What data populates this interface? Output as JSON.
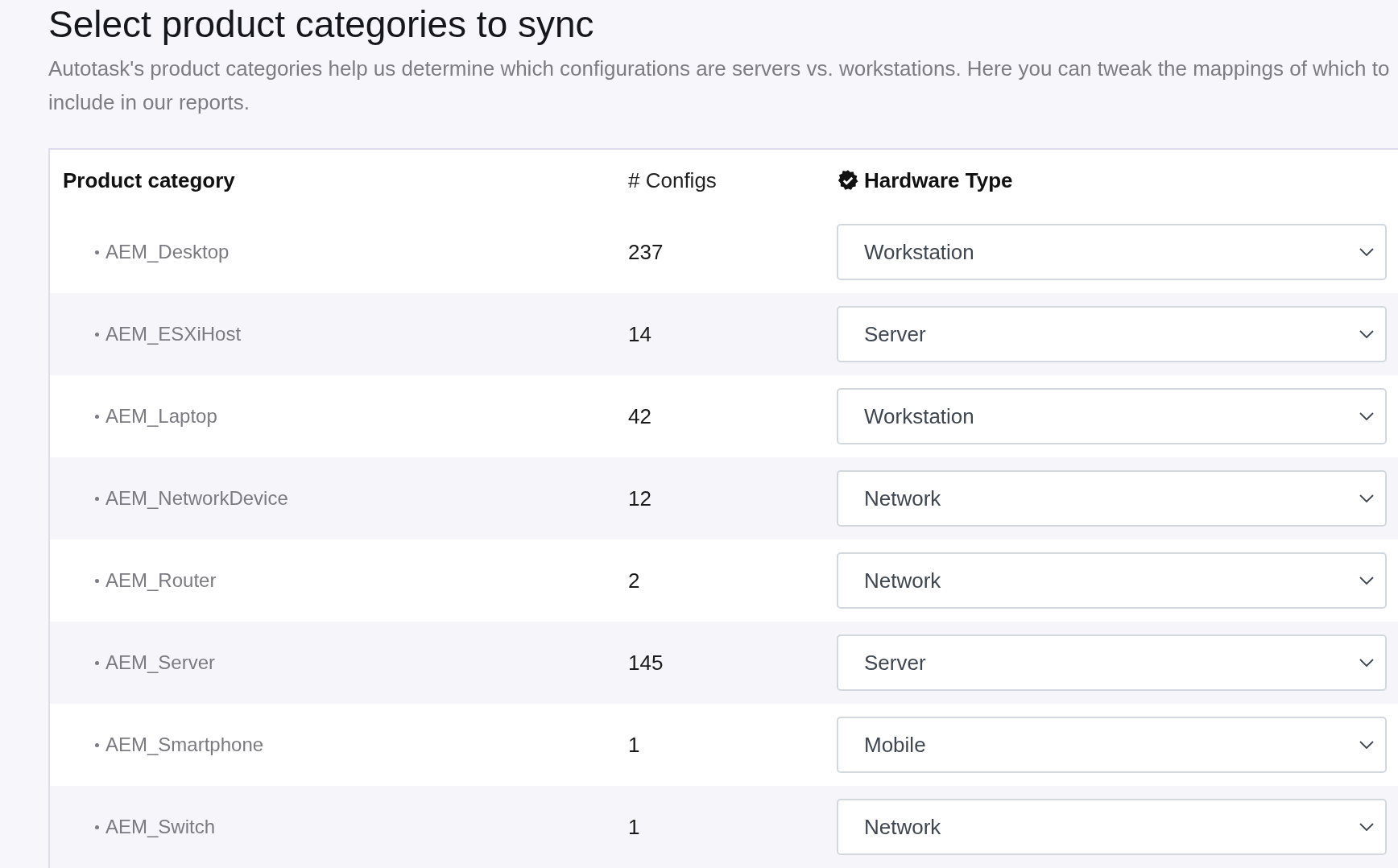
{
  "title": "Select product categories to sync",
  "description": "Autotask's product categories help us determine which configurations are servers vs. workstations. Here you can tweak the mappings of which to include in our reports.",
  "table": {
    "columns": [
      "Product category",
      "# Configs",
      "Hardware Type"
    ],
    "rows": [
      {
        "category": "AEM_Desktop",
        "configs": "237",
        "hardware_type": "Workstation"
      },
      {
        "category": "AEM_ESXiHost",
        "configs": "14",
        "hardware_type": "Server"
      },
      {
        "category": "AEM_Laptop",
        "configs": "42",
        "hardware_type": "Workstation"
      },
      {
        "category": "AEM_NetworkDevice",
        "configs": "12",
        "hardware_type": "Network"
      },
      {
        "category": "AEM_Router",
        "configs": "2",
        "hardware_type": "Network"
      },
      {
        "category": "AEM_Server",
        "configs": "145",
        "hardware_type": "Server"
      },
      {
        "category": "AEM_Smartphone",
        "configs": "1",
        "hardware_type": "Mobile"
      },
      {
        "category": "AEM_Switch",
        "configs": "1",
        "hardware_type": "Network"
      }
    ]
  }
}
